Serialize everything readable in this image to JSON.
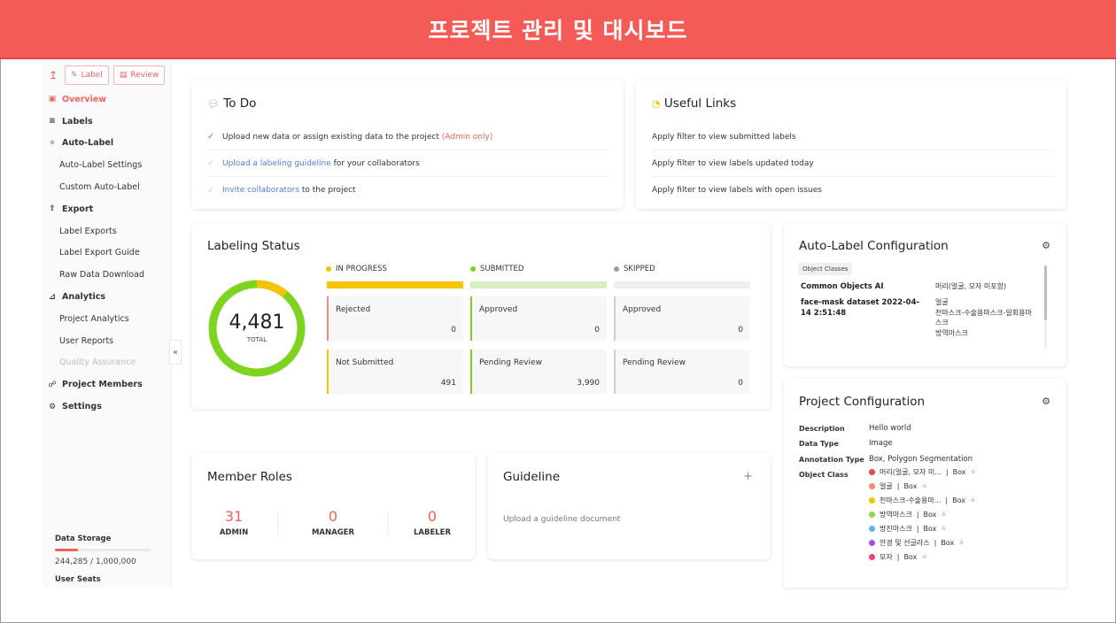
{
  "banner": {
    "title": "프로젝트 관리 및 대시보드"
  },
  "toolbar": {
    "upload_icon": "upload-icon",
    "label_btn": "Label",
    "review_btn": "Review"
  },
  "sidebar": {
    "items": [
      {
        "label": "Overview",
        "icon": "calendar-icon",
        "kind": "section active"
      },
      {
        "label": "Labels",
        "icon": "list-icon",
        "kind": "section"
      },
      {
        "label": "Auto-Label",
        "icon": "sparkle-icon",
        "kind": "section"
      },
      {
        "label": "Auto-Label Settings",
        "kind": "sub"
      },
      {
        "label": "Custom Auto-Label",
        "kind": "sub"
      },
      {
        "label": "Export",
        "icon": "export-icon",
        "kind": "section"
      },
      {
        "label": "Label Exports",
        "kind": "sub"
      },
      {
        "label": "Label Export Guide",
        "kind": "sub"
      },
      {
        "label": "Raw Data Download",
        "kind": "sub"
      },
      {
        "label": "Analytics",
        "icon": "chart-icon",
        "kind": "section"
      },
      {
        "label": "Project Analytics",
        "kind": "sub"
      },
      {
        "label": "User Reports",
        "kind": "sub"
      },
      {
        "label": "Quality Assurance",
        "kind": "sub disabled"
      },
      {
        "label": "Project Members",
        "icon": "members-icon",
        "kind": "section"
      },
      {
        "label": "Settings",
        "icon": "gear-icon",
        "kind": "section"
      }
    ],
    "storage_label": "Data Storage",
    "storage_value": "244,285 / 1,000,000",
    "storage_fraction": 0.244,
    "seats_label": "User Seats",
    "collapse_glyph": "«"
  },
  "todo": {
    "title": "To Do",
    "row1": {
      "strong": "Upload new data",
      "mid1": " or ",
      "strong2": "assign existing data",
      "mid2": " to the project ",
      "note": "(Admin only)"
    },
    "row2": {
      "link": "Upload a labeling guideline",
      "rest": " for your collaborators"
    },
    "row3": {
      "link": "Invite collaborators",
      "rest": " to the project"
    }
  },
  "links": {
    "title": "Useful Links",
    "items": [
      "Apply filter to view submitted labels",
      "Apply filter to view labels updated today",
      "Apply filter to view labels with open issues"
    ]
  },
  "status": {
    "title": "Labeling Status",
    "total": "4,481",
    "total_label": "TOTAL",
    "columns": [
      {
        "name": "IN PROGRESS",
        "color": "#f5c400",
        "bar": "#f5c400",
        "cells": [
          {
            "title": "Rejected",
            "value": "0"
          },
          {
            "title": "Not Submitted",
            "value": "491"
          }
        ]
      },
      {
        "name": "SUBMITTED",
        "color": "#7ed321",
        "bar": "#d8efc0",
        "cells": [
          {
            "title": "Approved",
            "value": "0"
          },
          {
            "title": "Pending Review",
            "value": "3,990"
          }
        ]
      },
      {
        "name": "SKIPPED",
        "color": "#9e9e9e",
        "bar": "#eeeeee",
        "cells": [
          {
            "title": "Approved",
            "value": "0"
          },
          {
            "title": "Pending Review",
            "value": "0"
          }
        ]
      }
    ]
  },
  "roles": {
    "title": "Member Roles",
    "items": [
      {
        "count": "31",
        "label": "ADMIN"
      },
      {
        "count": "0",
        "label": "MANAGER"
      },
      {
        "count": "0",
        "label": "LABELER"
      }
    ]
  },
  "guideline": {
    "title": "Guideline",
    "plus": "+",
    "empty": "Upload a guideline document"
  },
  "autolabel": {
    "title": "Auto-Label Configuration",
    "chip": "Object Classes",
    "rows": [
      {
        "name": "Common Objects AI",
        "classes": "머리(얼굴, 모자 미포함)"
      },
      {
        "name": "face-mask dataset 2022-04-14 2:51:48",
        "classes": "얼굴\n천마스크-수술용마스크-일회용마스크\n방역마스크"
      }
    ]
  },
  "projconfig": {
    "title": "Project Configuration",
    "description_key": "Description",
    "description": "Hello world",
    "datatype_key": "Data Type",
    "datatype": "Image",
    "annot_key": "Annotation Type",
    "annot": "Box, Polygon Segmentation",
    "class_key": "Object Class",
    "classes": [
      {
        "name": "머리(얼굴, 모자 미...",
        "type": "Box",
        "color": "#f0404f"
      },
      {
        "name": "얼굴",
        "type": "Box",
        "color": "#f58c6b"
      },
      {
        "name": "천마스크-수술용마...",
        "type": "Box",
        "color": "#f5c400"
      },
      {
        "name": "방역마스크",
        "type": "Box",
        "color": "#8fd649"
      },
      {
        "name": "방진마스크",
        "type": "Box",
        "color": "#5bb6f0"
      },
      {
        "name": "안경 및 선글라스",
        "type": "Box",
        "color": "#a64de8"
      },
      {
        "name": "모자",
        "type": "Box",
        "color": "#f0407a"
      }
    ]
  }
}
